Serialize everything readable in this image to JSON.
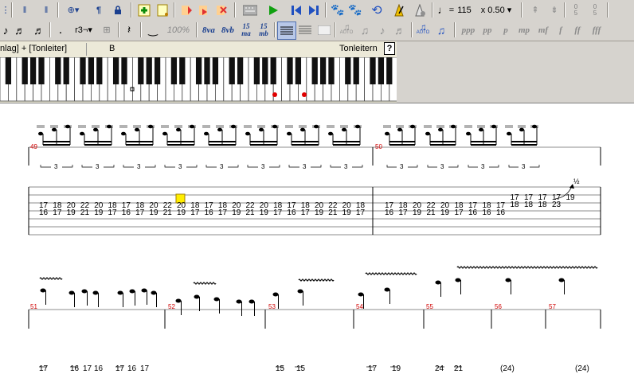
{
  "toolbar_top": {
    "tempo_value": "115",
    "speed_value": "x 0.50",
    "icons": [
      "pilcrow-icon",
      "lock-icon",
      "add-track-icon",
      "edit-track-icon",
      "bookmark-red-icon",
      "bookmark-arrow-icon",
      "bookmark-x-icon",
      "keyboard-icon",
      "play-icon",
      "skip-back-icon",
      "skip-forward-icon",
      "paw-icon",
      "paw2-icon",
      "loop-icon",
      "metronome-icon",
      "metronome-settings-icon"
    ],
    "spin1_top": "0",
    "spin1_bottom": "5",
    "spin2_top": "0",
    "spin2_bottom": "5"
  },
  "toolbar_bottom": {
    "tuplet_label": "r3¬",
    "zoom_label": "100%",
    "octave_labels": [
      "8va",
      "8vb",
      "15 ma",
      "15 mb"
    ],
    "auto_label_1": "AUTO",
    "auto_label_2": "AUTO",
    "dynamics": [
      "ppp",
      "pp",
      "p",
      "mp",
      "mf",
      "f",
      "ff",
      "fff"
    ]
  },
  "track_header": {
    "track_label": "nlag] + [Tonleiter]",
    "section_label": "B",
    "marker_label": "Tonleitern",
    "help_label": "?"
  },
  "piano": {
    "red_dots": 2
  },
  "score": {
    "bar_numbers_row1": [
      "49",
      "50"
    ],
    "bar_numbers_row2": [
      "51",
      "52",
      "53",
      "54",
      "55",
      "56",
      "57"
    ],
    "triplet_label": "3",
    "bend_label": "½",
    "tab_bar49_top": [
      "17",
      "18",
      "20",
      "22",
      "20",
      "18",
      "17",
      "18",
      "20",
      "22",
      "20",
      "18",
      "17",
      "18",
      "20",
      "22",
      "20",
      "18",
      "17",
      "18",
      "20",
      "22",
      "20",
      "18"
    ],
    "tab_bar49_bottom": [
      "16",
      "17",
      "19",
      "21",
      "19",
      "17",
      "16",
      "17",
      "19",
      "21",
      "19",
      "17",
      "16",
      "17",
      "19",
      "21",
      "19",
      "17",
      "16",
      "17",
      "19",
      "21",
      "19",
      "17"
    ],
    "tab_bar50_top": [
      "17",
      "18",
      "20",
      "22",
      "20",
      "18",
      "17",
      "18",
      "17",
      "17",
      "17",
      "17",
      "17",
      "19"
    ],
    "tab_bar50_bottom": [
      "16",
      "17",
      "19",
      "21",
      "19",
      "17",
      "16",
      "16",
      "16",
      "18",
      "18",
      "18",
      "23",
      ""
    ],
    "row2_partial_numbers": [
      "17",
      "16",
      "17",
      "16",
      "17",
      "16",
      "17",
      "15",
      "15",
      "17",
      "19",
      "24",
      "21",
      "(24)",
      "(24)"
    ]
  }
}
